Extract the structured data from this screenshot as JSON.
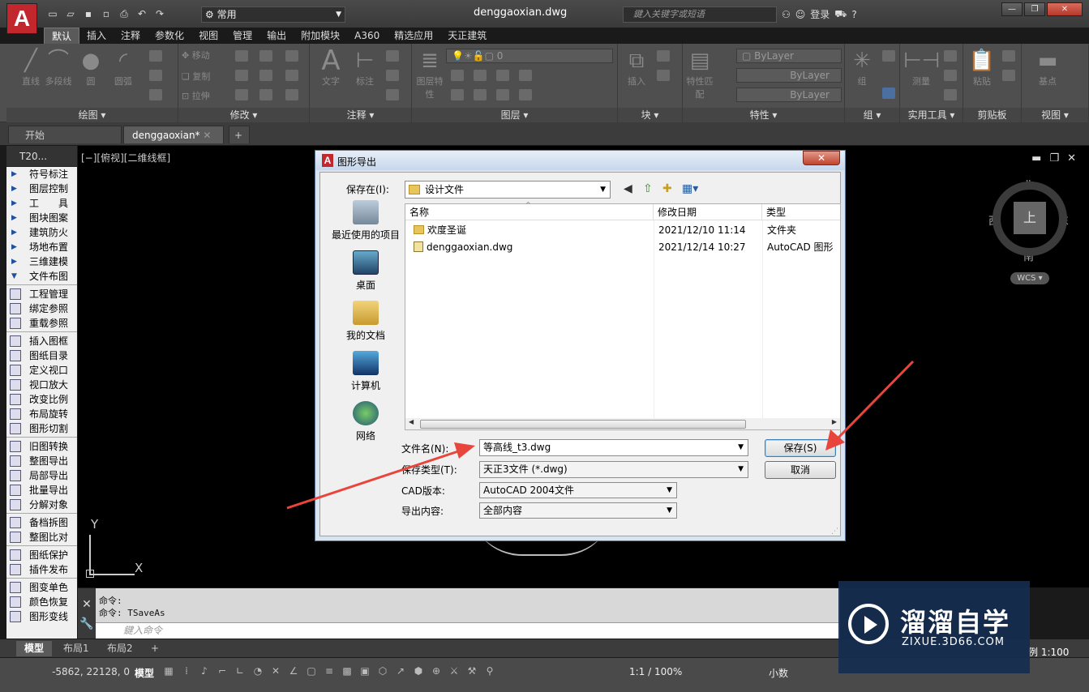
{
  "titlebar": {
    "logo": "A",
    "workspace": "常用",
    "document": "denggaoxian.dwg",
    "search_placeholder": "鍵入关键字或短语",
    "login": "登录"
  },
  "ribbon_tabs": [
    "默认",
    "插入",
    "注释",
    "参数化",
    "视图",
    "管理",
    "输出",
    "附加模块",
    "A360",
    "精选应用",
    "天正建筑"
  ],
  "ribbon_panels": {
    "draw": {
      "title": "绘图 ▾",
      "tools": [
        "直线",
        "多段线",
        "圆",
        "圆弧"
      ]
    },
    "modify": {
      "title": "修改 ▾",
      "tools": [
        "移动",
        "复制",
        "拉伸"
      ]
    },
    "annotation": {
      "title": "注释 ▾",
      "tools": [
        "文字",
        "标注"
      ]
    },
    "layers": {
      "title": "图层 ▾",
      "tools": [
        "图层特性"
      ],
      "layer_value": "0"
    },
    "block": {
      "title": "块 ▾",
      "tools": [
        "插入"
      ]
    },
    "properties": {
      "title": "特性 ▾",
      "tools": [
        "特性匹配"
      ],
      "bylayer": "ByLayer"
    },
    "groups": {
      "title": "组 ▾",
      "tools": [
        "组"
      ]
    },
    "utilities": {
      "title": "实用工具 ▾",
      "tools": [
        "测量"
      ]
    },
    "clipboard": {
      "title": "剪贴板",
      "tools": [
        "粘贴"
      ]
    },
    "view": {
      "title": "视图 ▾",
      "tools": [
        "基点"
      ]
    }
  },
  "file_tabs": [
    "开始",
    "denggaoxian*"
  ],
  "palette": {
    "title": "T20...",
    "groups_collapsed": [
      "符号标注",
      "图层控制",
      "工　　具",
      "图块图案",
      "建筑防火",
      "场地布置",
      "三维建模"
    ],
    "group_open": "文件布图",
    "items": [
      [
        "工程管理",
        "绑定参照",
        "重载参照"
      ],
      [
        "插入图框",
        "图纸目录",
        "定义视口",
        "视口放大",
        "改变比例",
        "布局旋转",
        "图形切割"
      ],
      [
        "旧图转换",
        "整图导出",
        "局部导出",
        "批量导出",
        "分解对象"
      ],
      [
        "备档拆图",
        "整图比对"
      ],
      [
        "图纸保护",
        "插件发布"
      ],
      [
        "图变单色",
        "颜色恢复",
        "图形变线"
      ]
    ]
  },
  "canvas": {
    "view_label": "[−][俯视][二维线框]",
    "compass": {
      "top": "上",
      "north": "北",
      "south": "南",
      "east": "东",
      "west": "西",
      "wcs": "WCS ▾"
    },
    "ucs_x": "X",
    "ucs_y": "Y"
  },
  "command": {
    "history": [
      "命令:",
      "命令: TSaveAs"
    ],
    "placeholder": "鍵入命令"
  },
  "layout_tabs": [
    "模型",
    "布局1",
    "布局2"
  ],
  "status": {
    "coords": "-5862, 22128, 0",
    "model": "模型",
    "scale": "1:1 / 100%",
    "units": "小数",
    "scale_right": "例 1:100"
  },
  "watermark": {
    "title": "溜溜自学",
    "url": "ZIXUE.3D66.COM"
  },
  "dialog": {
    "title": "图形导出",
    "close": "✕",
    "save_in_label": "保存在(I):",
    "save_in_value": "设计文件",
    "places": [
      "最近使用的项目",
      "桌面",
      "我的文档",
      "计算机",
      "网络"
    ],
    "columns": [
      "名称",
      "修改日期",
      "类型"
    ],
    "files": [
      {
        "name": "欢度圣诞",
        "date": "2021/12/10 11:14",
        "type": "文件夹",
        "kind": "folder"
      },
      {
        "name": "denggaoxian.dwg",
        "date": "2021/12/14 10:27",
        "type": "AutoCAD 图形",
        "kind": "dwg"
      }
    ],
    "filename_label": "文件名(N):",
    "filename_value": "等高线_t3.dwg",
    "filetype_label": "保存类型(T):",
    "filetype_value": "天正3文件 (*.dwg)",
    "cadver_label": "CAD版本:",
    "cadver_value": "AutoCAD 2004文件",
    "export_label": "导出内容:",
    "export_value": "全部内容",
    "save_button": "保存(S)",
    "cancel_button": "取消"
  },
  "colors": {
    "accent_arrow": "#e8453c",
    "autocad_red": "#c1272d",
    "canvas": "#000000"
  }
}
